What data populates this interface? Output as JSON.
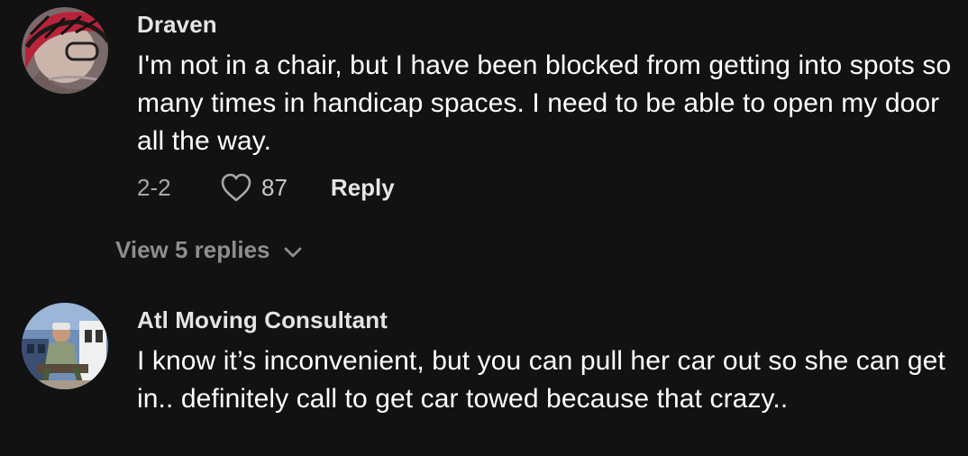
{
  "comments": [
    {
      "username": "Draven",
      "text": "I'm not in a chair, but I have been blocked from getting into spots so many times in handicap spaces. I need to be able to open my door all the way.",
      "date": "2-2",
      "likes": "87",
      "reply_label": "Reply",
      "view_replies_label": "View 5 replies",
      "avatar_icon": "user-avatar-icon"
    },
    {
      "username": "Atl Moving Consultant",
      "text": "I know it’s inconvenient, but you can pull her car out so she can get in.. definitely call to get car towed because that crazy..",
      "avatar_icon": "user-avatar-icon"
    }
  ],
  "colors": {
    "background": "#121212",
    "text": "#ffffff",
    "muted": "#a8a8a8"
  }
}
